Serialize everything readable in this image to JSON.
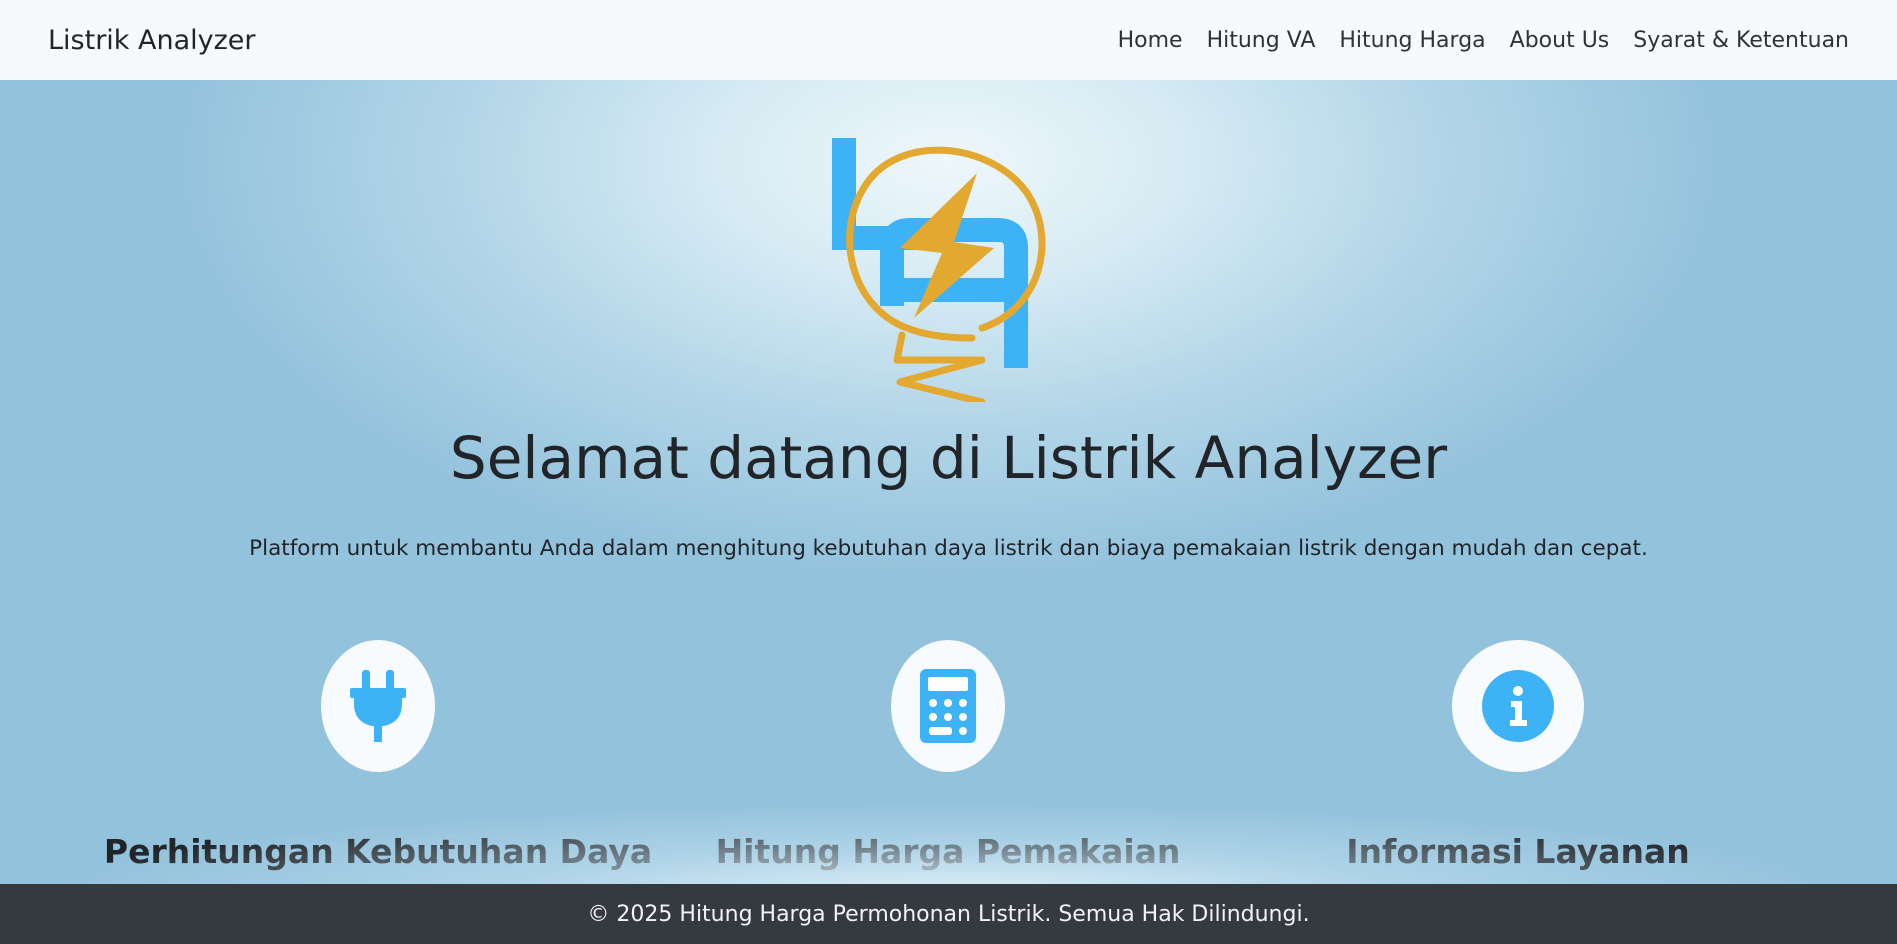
{
  "navbar": {
    "brand": "Listrik Analyzer",
    "links": [
      "Home",
      "Hitung VA",
      "Hitung Harga",
      "About Us",
      "Syarat & Ketentuan"
    ]
  },
  "hero": {
    "title": "Selamat datang di Listrik Analyzer",
    "subtitle": "Platform untuk membantu Anda dalam menghitung kebutuhan daya listrik dan biaya pemakaian listrik dengan mudah dan cepat."
  },
  "features": [
    {
      "title": "Perhitungan Kebutuhan Daya",
      "icon": "plug-icon"
    },
    {
      "title": "Hitung Harga Pemakaian",
      "icon": "calculator-icon"
    },
    {
      "title": "Informasi Layanan",
      "icon": "info-icon"
    }
  ],
  "footer": {
    "text": "© 2025 Hitung Harga Permohonan Listrik. Semua Hak Dilindungi."
  },
  "colors": {
    "accent_blue": "#3db3f5",
    "logo_gold": "#e3a830",
    "footer_bg": "#343a40",
    "navbar_bg": "#f8f9fa"
  }
}
